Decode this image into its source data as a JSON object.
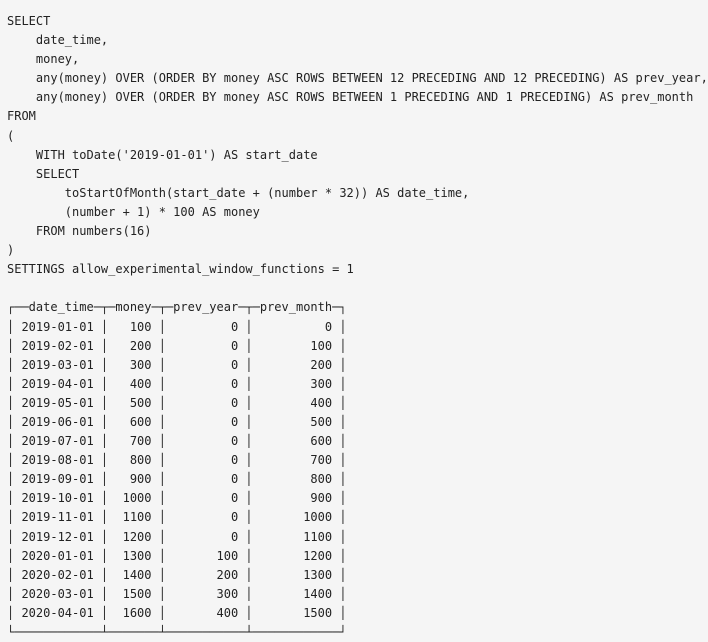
{
  "query": {
    "lines": [
      "SELECT",
      "    date_time,",
      "    money,",
      "    any(money) OVER (ORDER BY money ASC ROWS BETWEEN 12 PRECEDING AND 12 PRECEDING) AS prev_year,",
      "    any(money) OVER (ORDER BY money ASC ROWS BETWEEN 1 PRECEDING AND 1 PRECEDING) AS prev_month",
      "FROM",
      "(",
      "    WITH toDate('2019-01-01') AS start_date",
      "    SELECT",
      "        toStartOfMonth(start_date + (number * 32)) AS date_time,",
      "        (number + 1) * 100 AS money",
      "    FROM numbers(16)",
      ")",
      "SETTINGS allow_experimental_window_functions = 1"
    ]
  },
  "result": {
    "lines": [
      "┌──date_time─┬─money─┬─prev_year─┬─prev_month─┐",
      "│ 2019-01-01 │   100 │         0 │          0 │",
      "│ 2019-02-01 │   200 │         0 │        100 │",
      "│ 2019-03-01 │   300 │         0 │        200 │",
      "│ 2019-04-01 │   400 │         0 │        300 │",
      "│ 2019-05-01 │   500 │         0 │        400 │",
      "│ 2019-06-01 │   600 │         0 │        500 │",
      "│ 2019-07-01 │   700 │         0 │        600 │",
      "│ 2019-08-01 │   800 │         0 │        700 │",
      "│ 2019-09-01 │   900 │         0 │        800 │",
      "│ 2019-10-01 │  1000 │         0 │        900 │",
      "│ 2019-11-01 │  1100 │         0 │       1000 │",
      "│ 2019-12-01 │  1200 │         0 │       1100 │",
      "│ 2020-01-01 │  1300 │       100 │       1200 │",
      "│ 2020-02-01 │  1400 │       200 │       1300 │",
      "│ 2020-03-01 │  1500 │       300 │       1400 │",
      "│ 2020-04-01 │  1600 │       400 │       1500 │",
      "└────────────┴───────┴───────────┴────────────┘"
    ]
  }
}
